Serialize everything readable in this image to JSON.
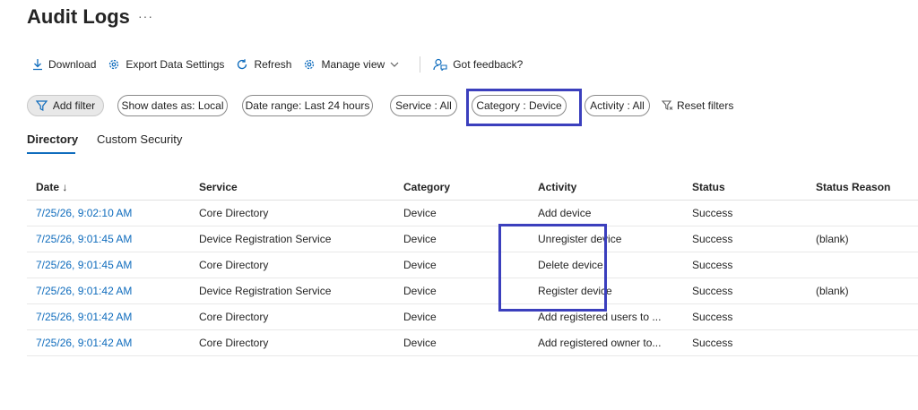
{
  "page": {
    "title": "Audit Logs",
    "more": "···"
  },
  "toolbar": {
    "download": "Download",
    "export": "Export Data Settings",
    "refresh": "Refresh",
    "manage_view": "Manage view",
    "feedback": "Got feedback?"
  },
  "filters": {
    "add_filter": "Add filter",
    "show_dates": "Show dates as: Local",
    "date_range": "Date range: Last 24 hours",
    "service": "Service : All",
    "category": "Category : Device",
    "activity": "Activity : All",
    "reset": "Reset filters"
  },
  "tabs": [
    {
      "label": "Directory",
      "active": true
    },
    {
      "label": "Custom Security",
      "active": false
    }
  ],
  "table": {
    "headers": [
      "Date ↓",
      "Service",
      "Category",
      "Activity",
      "Status",
      "Status Reason"
    ],
    "rows": [
      [
        "7/25/26, 9:02:10 AM",
        "Core Directory",
        "Device",
        "Add device",
        "Success",
        ""
      ],
      [
        "7/25/26, 9:01:45 AM",
        "Device Registration Service",
        "Device",
        "Unregister device",
        "Success",
        "(blank)"
      ],
      [
        "7/25/26, 9:01:45 AM",
        "Core Directory",
        "Device",
        "Delete device",
        "Success",
        ""
      ],
      [
        "7/25/26, 9:01:42 AM",
        "Device Registration Service",
        "Device",
        "Register device",
        "Success",
        "(blank)"
      ],
      [
        "7/25/26, 9:01:42 AM",
        "Core Directory",
        "Device",
        "Add registered users to ...",
        "Success",
        ""
      ],
      [
        "7/25/26, 9:01:42 AM",
        "Core Directory",
        "Device",
        "Add registered owner to...",
        "Success",
        ""
      ]
    ]
  },
  "colors": {
    "link": "#0f6cbd",
    "highlight": "#3b3fbd"
  }
}
